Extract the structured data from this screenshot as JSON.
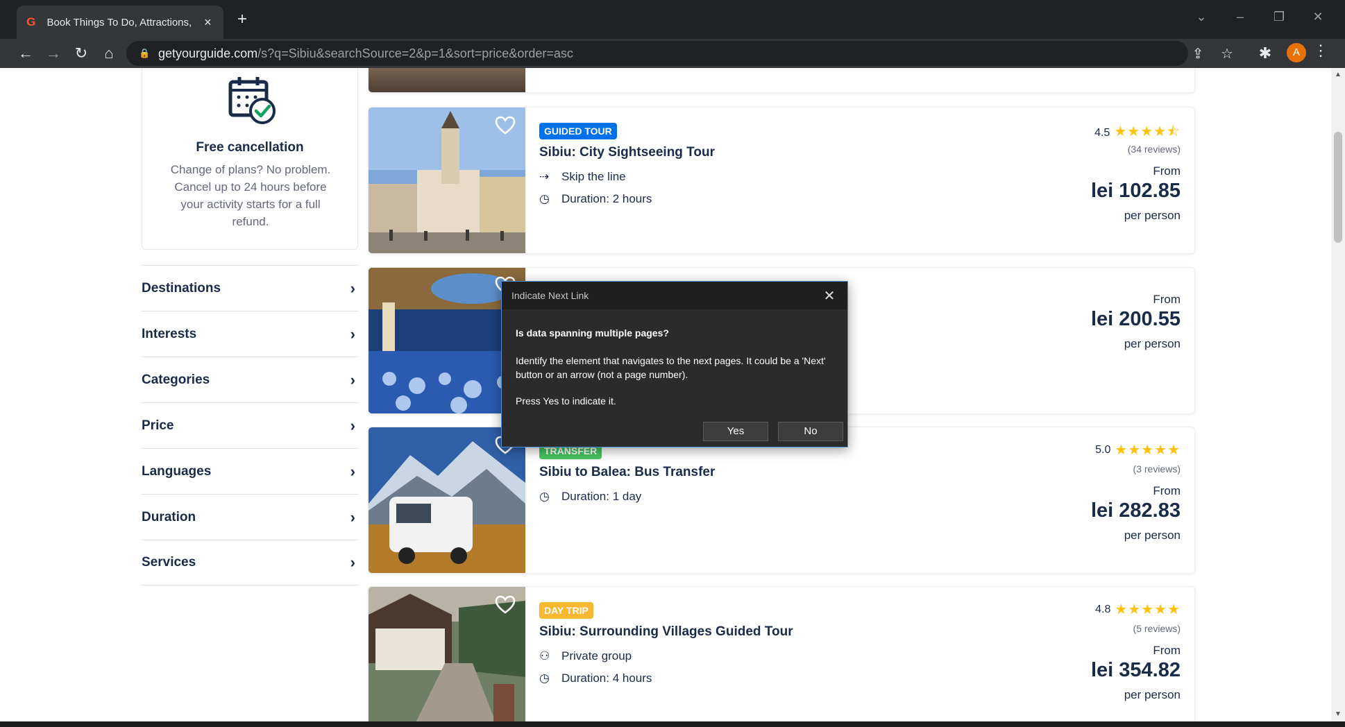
{
  "browser": {
    "tab_title": "Book Things To Do, Attractions, a",
    "url_domain": "getyourguide.com",
    "url_path": "/s?q=Sibiu&searchSource=2&p=1&sort=price&order=asc",
    "profile_initial": "A"
  },
  "sidebar": {
    "cancel_title": "Free cancellation",
    "cancel_text": "Change of plans? No problem. Cancel up to 24 hours before your activity starts for a full refund.",
    "filters": [
      {
        "label": "Destinations"
      },
      {
        "label": "Interests"
      },
      {
        "label": "Categories"
      },
      {
        "label": "Price"
      },
      {
        "label": "Languages"
      },
      {
        "label": "Duration"
      },
      {
        "label": "Services"
      }
    ]
  },
  "cards": [
    {
      "badge": "GUIDED TOUR",
      "badge_color": "#0071eb",
      "title": "Sibiu: City Sightseeing Tour",
      "features": [
        "Skip the line",
        "Duration: 2 hours"
      ],
      "rating": "4.5",
      "stars": "★★★★⯪",
      "reviews": "(34 reviews)",
      "from": "From",
      "price": "lei 102.85",
      "per": "per person"
    },
    {
      "badge": "",
      "title": "",
      "features": [],
      "from": "From",
      "price": "lei 200.55",
      "per": "per person"
    },
    {
      "badge": "TRANSFER",
      "badge_color": "#47c25f",
      "title": "Sibiu to Balea: Bus Transfer",
      "features": [
        "Duration: 1 day"
      ],
      "rating": "5.0",
      "stars": "★★★★★",
      "reviews": "(3 reviews)",
      "from": "From",
      "price": "lei 282.83",
      "per": "per person"
    },
    {
      "badge": "DAY TRIP",
      "badge_color": "#f7b731",
      "title": "Sibiu: Surrounding Villages Guided Tour",
      "features": [
        "Private group",
        "Duration: 4 hours"
      ],
      "rating": "4.8",
      "stars": "★★★★★",
      "reviews": "(5 reviews)",
      "from": "From",
      "price": "lei 354.82",
      "per": "per person"
    }
  ],
  "dialog": {
    "title": "Indicate Next Link",
    "question": "Is data spanning multiple pages?",
    "body": "Identify the element that navigates to the next pages. It could be a 'Next' button or an arrow (not a page number).",
    "body2": "Press Yes to indicate it.",
    "yes": "Yes",
    "no": "No"
  }
}
